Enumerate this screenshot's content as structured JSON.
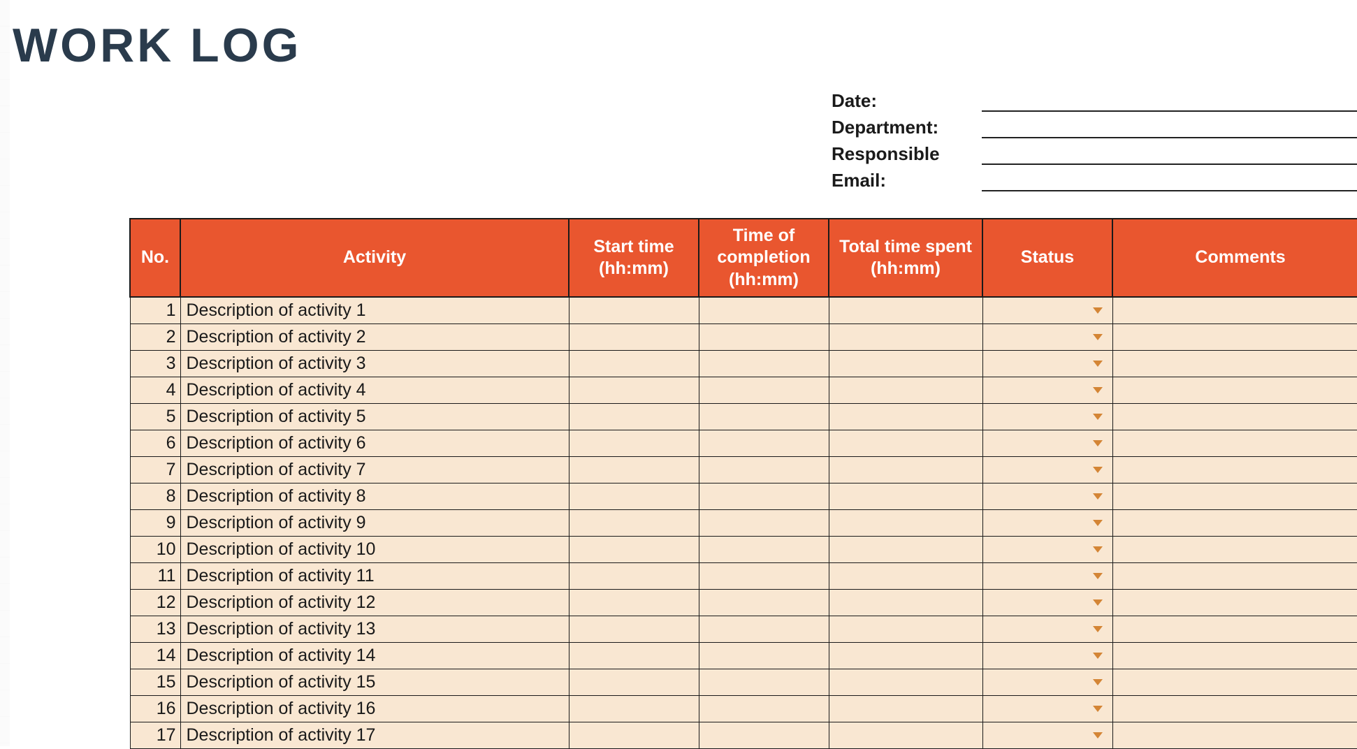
{
  "title": "WORK LOG",
  "meta": {
    "date_label": "Date:",
    "department_label": "Department:",
    "responsible_label": "Responsible",
    "email_label": "Email:",
    "date_value": "",
    "department_value": "",
    "responsible_value": "",
    "email_value": ""
  },
  "columns": {
    "no": "No.",
    "activity": "Activity",
    "start": "Start time (hh:mm)",
    "end": "Time of completion (hh:mm)",
    "total": "Total time spent (hh:mm)",
    "status": "Status",
    "comments": "Comments"
  },
  "rows": [
    {
      "no": "1",
      "activity": "Description of activity 1",
      "start": "",
      "end": "",
      "total": "",
      "status": "",
      "comments": ""
    },
    {
      "no": "2",
      "activity": "Description of activity 2",
      "start": "",
      "end": "",
      "total": "",
      "status": "",
      "comments": ""
    },
    {
      "no": "3",
      "activity": "Description of activity 3",
      "start": "",
      "end": "",
      "total": "",
      "status": "",
      "comments": ""
    },
    {
      "no": "4",
      "activity": "Description of activity 4",
      "start": "",
      "end": "",
      "total": "",
      "status": "",
      "comments": ""
    },
    {
      "no": "5",
      "activity": "Description of activity 5",
      "start": "",
      "end": "",
      "total": "",
      "status": "",
      "comments": ""
    },
    {
      "no": "6",
      "activity": "Description of activity 6",
      "start": "",
      "end": "",
      "total": "",
      "status": "",
      "comments": ""
    },
    {
      "no": "7",
      "activity": "Description of activity 7",
      "start": "",
      "end": "",
      "total": "",
      "status": "",
      "comments": ""
    },
    {
      "no": "8",
      "activity": "Description of activity 8",
      "start": "",
      "end": "",
      "total": "",
      "status": "",
      "comments": ""
    },
    {
      "no": "9",
      "activity": "Description of activity 9",
      "start": "",
      "end": "",
      "total": "",
      "status": "",
      "comments": ""
    },
    {
      "no": "10",
      "activity": "Description of activity 10",
      "start": "",
      "end": "",
      "total": "",
      "status": "",
      "comments": ""
    },
    {
      "no": "11",
      "activity": "Description of activity 11",
      "start": "",
      "end": "",
      "total": "",
      "status": "",
      "comments": ""
    },
    {
      "no": "12",
      "activity": "Description of activity 12",
      "start": "",
      "end": "",
      "total": "",
      "status": "",
      "comments": ""
    },
    {
      "no": "13",
      "activity": "Description of activity 13",
      "start": "",
      "end": "",
      "total": "",
      "status": "",
      "comments": ""
    },
    {
      "no": "14",
      "activity": "Description of activity 14",
      "start": "",
      "end": "",
      "total": "",
      "status": "",
      "comments": ""
    },
    {
      "no": "15",
      "activity": "Description of activity 15",
      "start": "",
      "end": "",
      "total": "",
      "status": "",
      "comments": ""
    },
    {
      "no": "16",
      "activity": "Description of activity 16",
      "start": "",
      "end": "",
      "total": "",
      "status": "",
      "comments": ""
    },
    {
      "no": "17",
      "activity": "Description of activity 17",
      "start": "",
      "end": "",
      "total": "",
      "status": "",
      "comments": ""
    }
  ]
}
